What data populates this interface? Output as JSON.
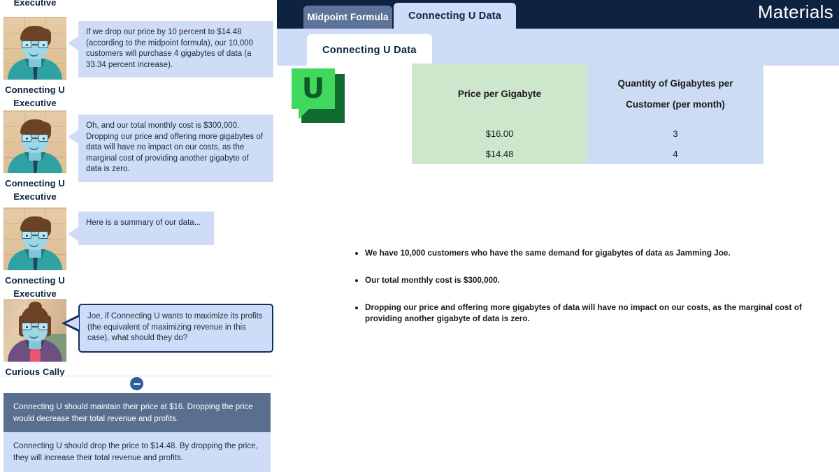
{
  "left_panel": {
    "cut_off_top_label": "Executive",
    "dialogs": [
      {
        "speaker_line1": "Connecting U",
        "speaker_line2": "Executive",
        "avatar": "male-executive-avatar",
        "text": "If we drop our price by 10 percent to $14.48 (according to the midpoint formula), our 10,000 customers will purchase 4 gigabytes of data (a 33.34 percent increase)."
      },
      {
        "speaker_line1": "Connecting U",
        "speaker_line2": "Executive",
        "avatar": "male-executive-avatar",
        "text": "Oh, and our total monthly cost is $300,000. Dropping our price and offering more gigabytes of data will have no impact on our costs, as the marginal cost of providing another gigabyte of data is zero."
      },
      {
        "speaker_line1": "Connecting U",
        "speaker_line2": "Executive",
        "avatar": "male-executive-avatar",
        "text": "Here is a summary of our data..."
      },
      {
        "speaker_line1": "Curious Cally",
        "speaker_line2": "",
        "avatar": "female-student-avatar",
        "text": "Joe, if Connecting U wants to maximize its profits (the equivalent of maximizing revenue in this case), what should they do?"
      }
    ],
    "collapse_button": "collapse",
    "answers": [
      {
        "text": "Connecting U should maintain their price at $16. Dropping the price would decrease their total revenue and profits.",
        "state": "selected"
      },
      {
        "text": "Connecting U should drop the price to $14.48. By dropping the price, they will increase their total revenue and profits.",
        "state": "normal"
      }
    ]
  },
  "right_panel": {
    "header_title": "Materials",
    "tabs": [
      {
        "label": "Midpoint Formula",
        "active": false
      },
      {
        "label": "Connecting U Data",
        "active": true
      }
    ],
    "subtab": {
      "label": "Connecting U Data",
      "active": true
    },
    "logo": {
      "letter": "U",
      "name": "connecting-u-logo"
    },
    "table": {
      "headers": [
        "Price per Gigabyte",
        "Quantity of Gigabytes per Customer (per month)"
      ],
      "header_qty_line1": "Quantity of Gigabytes per",
      "header_qty_line2": "Customer (per month)",
      "rows": [
        {
          "price": "$16.00",
          "quantity": "3"
        },
        {
          "price": "$14.48",
          "quantity": "4"
        }
      ]
    },
    "bullets": [
      "We have 10,000 customers who have the same demand for gigabytes of data as Jamming Joe.",
      "Our total monthly cost is $300,000.",
      "Dropping our price and offering more gigabytes of data will have no impact on our costs, as the marginal cost of providing another gigabyte of data is zero."
    ]
  },
  "colors": {
    "header_navy": "#0d2340",
    "tab_active": "#cfdcf7",
    "tab_inactive": "#5e7399",
    "bubble_blue": "#cfdcf7",
    "answer_selected": "#5a6e90",
    "table_green": "#cde6cc",
    "table_blue": "#cbdcf4",
    "logo_green": "#41d95d"
  }
}
